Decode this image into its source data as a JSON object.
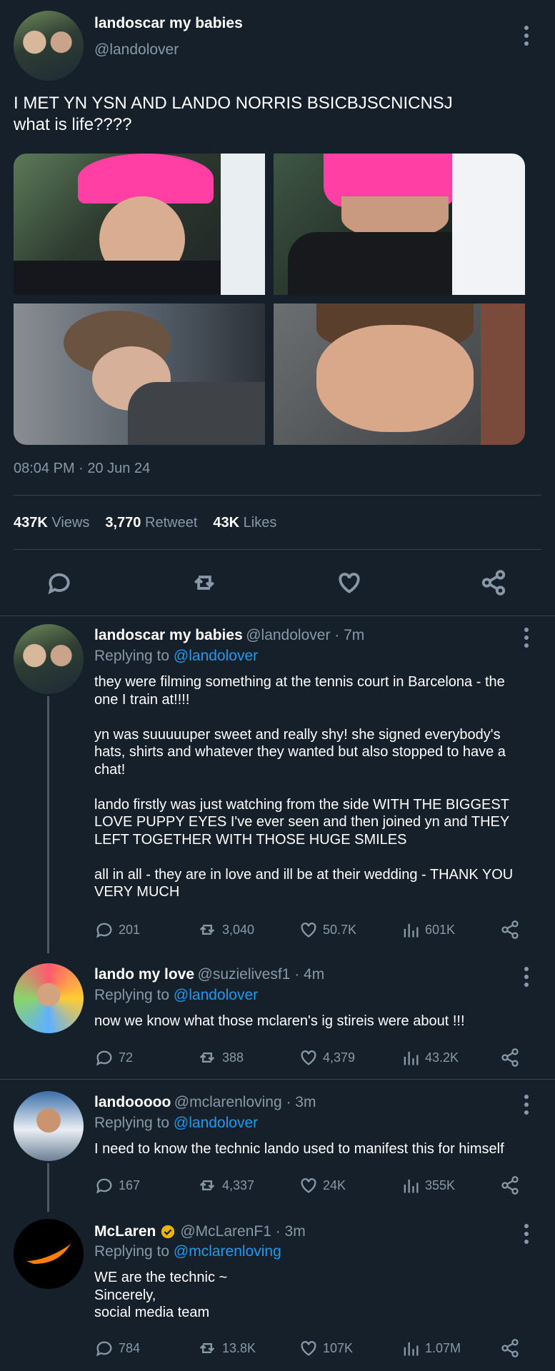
{
  "main_tweet": {
    "author_name": "landoscar my babies",
    "author_handle": "@landolover",
    "text": "I MET YN YSN AND LANDO NORRIS BSICBJSCNICNSJ\nwhat is life????",
    "timestamp": "08:04 PM · 20 Jun 24",
    "stats": {
      "views_value": "437K",
      "views_label": "Views",
      "retweets_value": "3,770",
      "retweets_label": "Retweet",
      "likes_value": "43K",
      "likes_label": "Likes"
    }
  },
  "replies": [
    {
      "author_name": "landoscar my babies",
      "author_handle": "@landolover · 7m",
      "replying_prefix": "Replying to ",
      "replying_to": "@landolover",
      "text": "they were filming something at the tennis court in Barcelona - the\none I train at!!!!\n\nyn was suuuuuper sweet and really shy! she signed everybody's\nhats, shirts and whatever they wanted but also stopped to have a\nchat!\n\nlando firstly was just watching from the side WITH THE BIGGEST\nLOVE PUPPY EYES I've ever seen and then joined yn and THEY\nLEFT TOGETHER WITH THOSE HUGE SMILES\n\nall in all - they are in love and ill be at their wedding - THANK YOU\nVERY MUCH",
      "replies": "201",
      "retweets": "3,040",
      "likes": "50.7K",
      "views": "601K"
    },
    {
      "author_name": "lando my love",
      "author_handle": "@suzielivesf1 · 4m",
      "replying_prefix": "Replying to ",
      "replying_to": "@landolover",
      "text": "now we know what those mclaren's ig stireis were about !!!",
      "replies": "72",
      "retweets": "388",
      "likes": "4,379",
      "views": "43.2K"
    },
    {
      "author_name": "landooooo",
      "author_handle": "@mclarenloving · 3m",
      "replying_prefix": "Replying to ",
      "replying_to": "@landolover",
      "text": "I need to know the technic lando used to manifest this for himself",
      "replies": "167",
      "retweets": "4,337",
      "likes": "24K",
      "views": "355K"
    },
    {
      "author_name": "McLaren",
      "author_handle": "@McLarenF1 · 3m",
      "replying_prefix": "Replying to ",
      "replying_to": "@mclarenloving",
      "text": "WE are the technic ~\nSincerely,\nsocial media team",
      "replies": "784",
      "retweets": "13.8K",
      "likes": "107K",
      "views": "1.07M"
    }
  ],
  "colors": {
    "background": "#15202b",
    "muted": "#8899a6",
    "link": "#1d9bf0",
    "verified_badge": "#e8b500",
    "mclaren_orange": "#ff8000"
  },
  "icons": [
    "more-icon",
    "reply-icon",
    "retweet-icon",
    "like-icon",
    "share-icon",
    "views-icon",
    "verified-icon",
    "mclaren-logo"
  ]
}
